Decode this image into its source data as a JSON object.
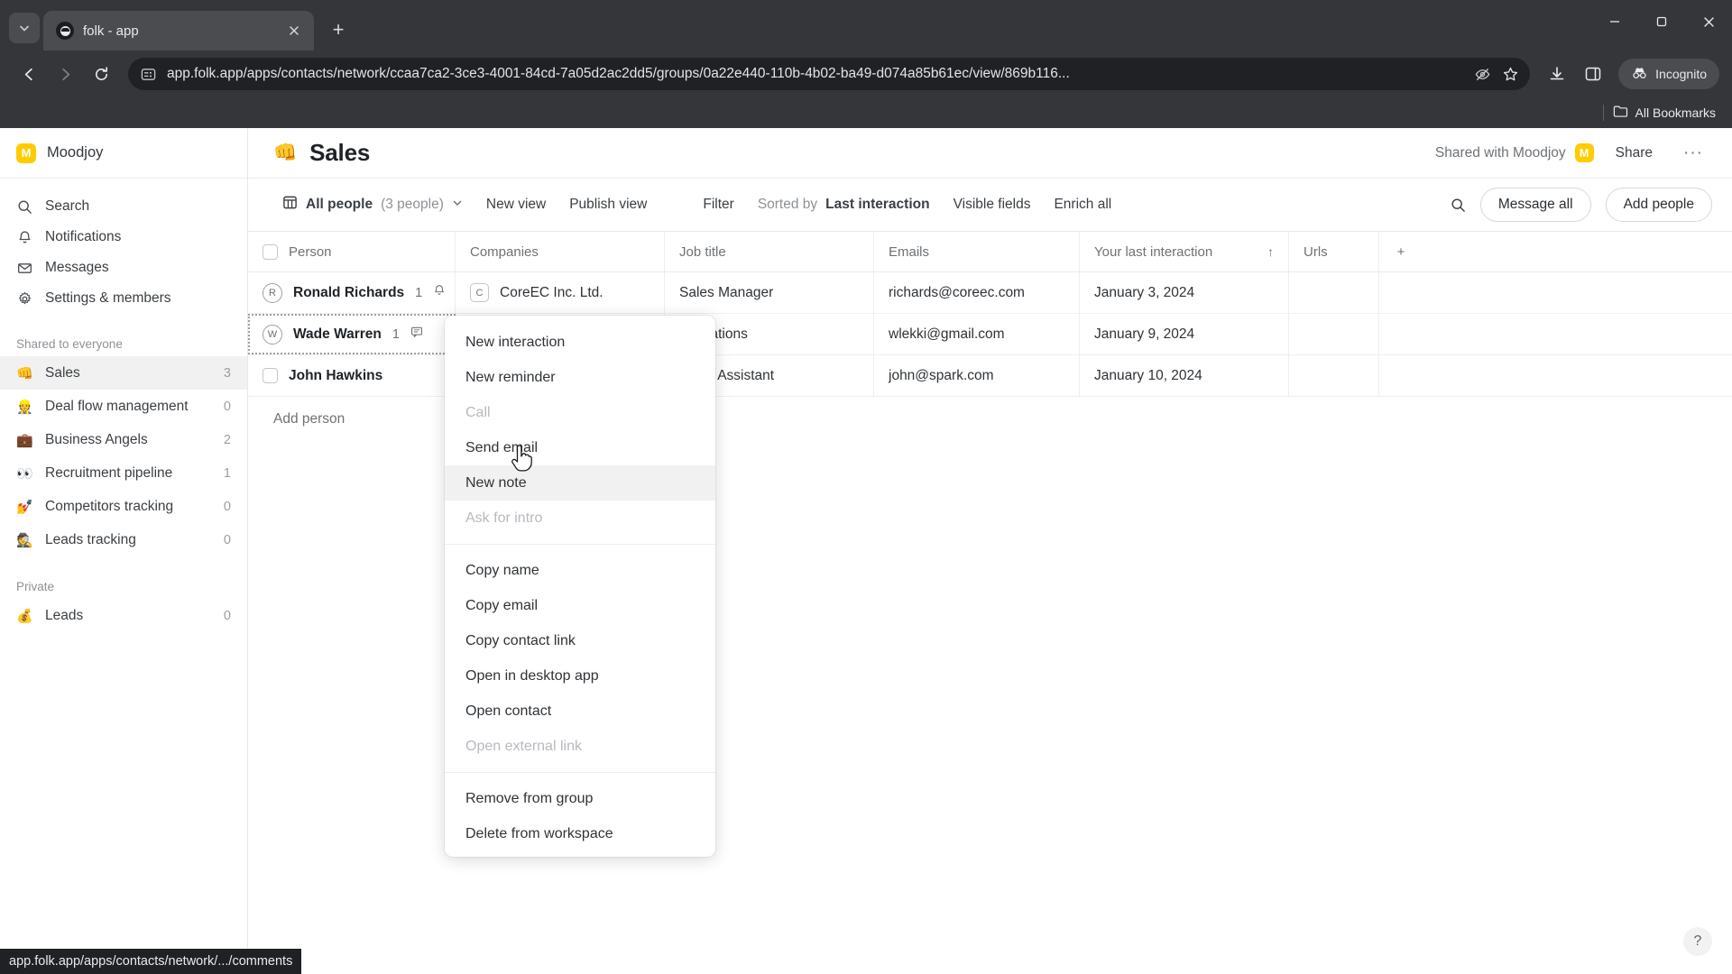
{
  "browser": {
    "tab": {
      "title": "folk - app",
      "favicon_icon": "folk-favicon-icon",
      "close_icon": "close-icon"
    },
    "new_tab_label": "+",
    "tab_search_icon": "tab-search-chevron-icon",
    "window": {
      "minimize": "—",
      "maximize": "❐",
      "close": "✕"
    },
    "nav": {
      "back": "←",
      "forward": "→",
      "reload": "⟳"
    },
    "omnibox": {
      "site_info_icon": "page-info-icon",
      "url": "app.folk.app/apps/contacts/network/ccaa7ca2-3ce3-4001-84cd-7a05d2ac2dd5/groups/0a22e440-110b-4b02-ba49-d074a85b61ec/view/869b116...",
      "hide_icon": "eye-off-icon",
      "bookmark_icon": "star-icon"
    },
    "toolbar_icons": [
      "download-icon",
      "side-panel-icon"
    ],
    "incognito_label": "Incognito",
    "incognito_icon": "incognito-hat-icon",
    "bookmarks": {
      "label": "All Bookmarks",
      "icon": "folder-icon"
    },
    "status_url": "app.folk.app/apps/contacts/network/.../comments"
  },
  "sidebar": {
    "workspace": {
      "name": "Moodjoy",
      "avatar_letter": "M",
      "avatar_color": "#ffcc00"
    },
    "nav": [
      {
        "label": "Search",
        "icon": "search-icon"
      },
      {
        "label": "Notifications",
        "icon": "bell-icon"
      },
      {
        "label": "Messages",
        "icon": "mail-icon"
      },
      {
        "label": "Settings & members",
        "icon": "gear-icon"
      }
    ],
    "shared_group_title": "Shared to everyone",
    "shared_items": [
      {
        "label": "Sales",
        "emoji": "👊",
        "count": "3",
        "active": true
      },
      {
        "label": "Deal flow management",
        "emoji": "👷",
        "count": "0",
        "active": false
      },
      {
        "label": "Business Angels",
        "emoji": "💼",
        "count": "2",
        "active": false
      },
      {
        "label": "Recruitment pipeline",
        "emoji": "👀",
        "count": "1",
        "active": false
      },
      {
        "label": "Competitors tracking",
        "emoji": "💅",
        "count": "0",
        "active": false
      },
      {
        "label": "Leads tracking",
        "emoji": "🕵️",
        "count": "0",
        "active": false
      }
    ],
    "private_group_title": "Private",
    "private_items": [
      {
        "label": "Leads",
        "emoji": "💰",
        "count": "0",
        "active": false
      }
    ]
  },
  "header": {
    "emoji": "👊",
    "title": "Sales",
    "shared_with": "Shared with Moodjoy",
    "shared_avatar_letter": "M",
    "share_label": "Share",
    "more_label": "···"
  },
  "toolbar": {
    "view_icon": "table-view-icon",
    "view_name": "All people",
    "view_count": "(3 people)",
    "view_chevron": "⌄",
    "new_view": "New view",
    "publish_view": "Publish view",
    "filter": "Filter",
    "sorted_by_prefix": "Sorted by",
    "sorted_by_value": "Last interaction",
    "visible_fields": "Visible fields",
    "enrich_all": "Enrich all",
    "search_icon": "search-icon",
    "message_all": "Message all",
    "add_people": "Add people"
  },
  "table": {
    "columns": [
      "Person",
      "Companies",
      "Job title",
      "Emails",
      "Your last interaction",
      "Urls"
    ],
    "sort_indicator": "↑",
    "add_column_label": "+",
    "rows": [
      {
        "person": "Ronald Richards",
        "person_initial": "R",
        "person_badge_count": "1",
        "person_badge_icon": "bell-icon",
        "company": "CoreEC Inc. Ltd.",
        "company_initial": "C",
        "job_title": "Sales Manager",
        "email": "richards@coreec.com",
        "last_interaction": "January 3, 2024",
        "url": "",
        "selected": false
      },
      {
        "person": "Wade Warren",
        "person_initial": "W",
        "person_badge_count": "1",
        "person_badge_icon": "comment-icon",
        "company": "",
        "company_initial": "",
        "job_title": "Operations",
        "email": "wlekki@gmail.com",
        "last_interaction": "January 9, 2024",
        "url": "",
        "selected": true
      },
      {
        "person": "John Hawkins",
        "person_initial": "",
        "person_badge_count": "",
        "person_badge_icon": "",
        "company": "",
        "company_initial": "",
        "job_title": "Sales Assistant",
        "email": "john@spark.com",
        "last_interaction": "January 10, 2024",
        "url": "",
        "selected": false
      }
    ],
    "add_person_label": "Add person"
  },
  "context_menu": {
    "groups": [
      [
        {
          "label": "New interaction",
          "disabled": false,
          "hovered": false
        },
        {
          "label": "New reminder",
          "disabled": false,
          "hovered": false
        },
        {
          "label": "Call",
          "disabled": true,
          "hovered": false
        },
        {
          "label": "Send email",
          "disabled": false,
          "hovered": false
        },
        {
          "label": "New note",
          "disabled": false,
          "hovered": true
        },
        {
          "label": "Ask for intro",
          "disabled": true,
          "hovered": false
        }
      ],
      [
        {
          "label": "Copy name",
          "disabled": false,
          "hovered": false
        },
        {
          "label": "Copy email",
          "disabled": false,
          "hovered": false
        },
        {
          "label": "Copy contact link",
          "disabled": false,
          "hovered": false
        },
        {
          "label": "Open in desktop app",
          "disabled": false,
          "hovered": false
        },
        {
          "label": "Open contact",
          "disabled": false,
          "hovered": false
        },
        {
          "label": "Open external link",
          "disabled": true,
          "hovered": false
        }
      ],
      [
        {
          "label": "Remove from group",
          "disabled": false,
          "hovered": false
        },
        {
          "label": "Delete from workspace",
          "disabled": false,
          "hovered": false
        }
      ]
    ]
  },
  "help_fab": {
    "label": "?"
  }
}
